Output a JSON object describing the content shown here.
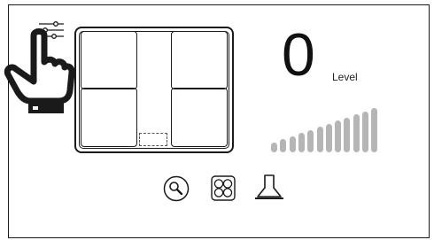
{
  "power": {
    "value": "0",
    "label": "Level"
  },
  "level_bar": {
    "segments": 12,
    "active_segments": 0,
    "color": "#b5b5b5"
  },
  "icons": {
    "settings": "sliders-icon",
    "hand": "pointing-hand-icon",
    "search": "search-icon",
    "zones": "cooking-zones-icon",
    "hood": "extractor-hood-icon"
  },
  "colors": {
    "line": "#1a1a1a",
    "bar": "#b5b5b5",
    "background": "#ffffff"
  }
}
